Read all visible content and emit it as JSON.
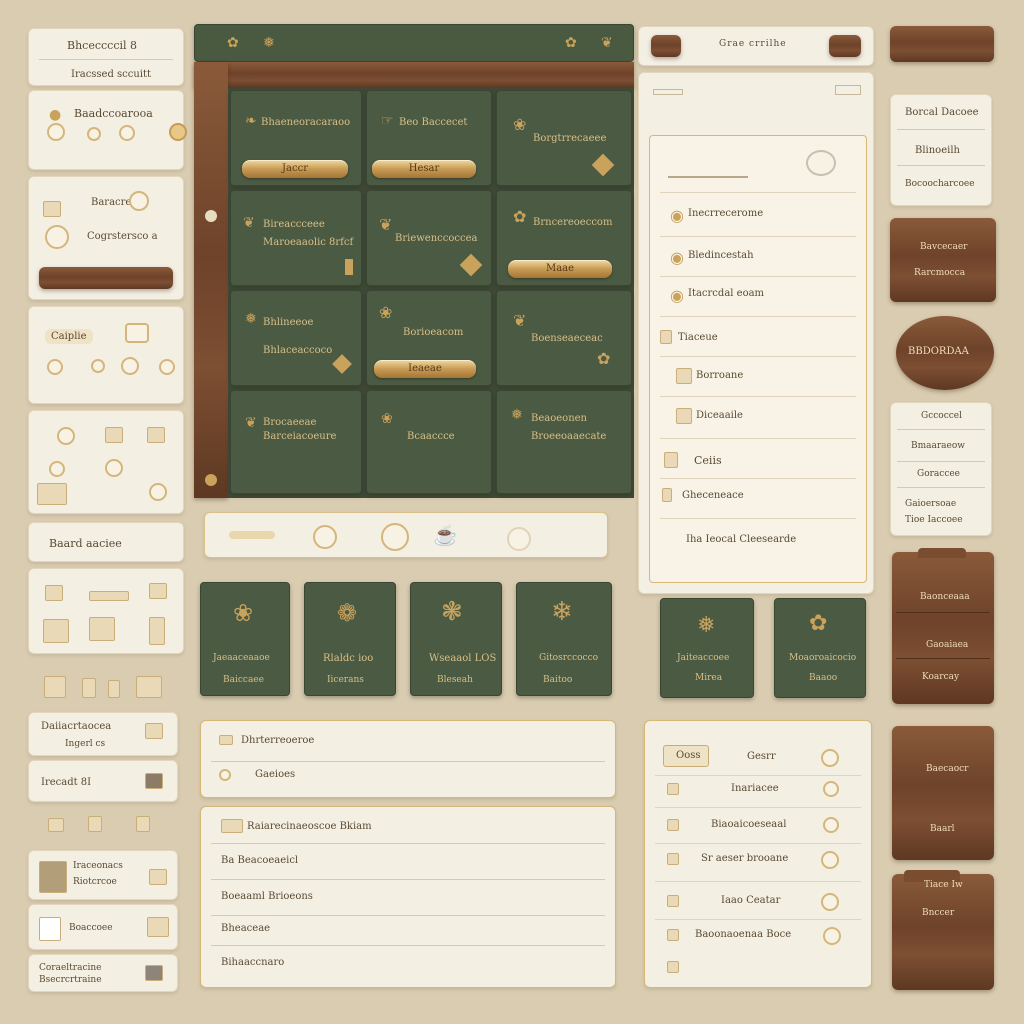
{
  "colors": {
    "background": "#d9ccb1",
    "card": "#f4efe3",
    "green": "#4b5a43",
    "wood": "#7a4d30",
    "gold": "#c9a25c"
  },
  "left_column": {
    "card1_title": "Bhceccccil 8",
    "card1_sub": "Iracssed sccuitt",
    "card2_title": "Baadccoarooa",
    "card3_title": "Baracres",
    "card3_label": "Cogrstersco a",
    "card4_label": "Caiplie",
    "card6_title": "Baard aaciee",
    "list1": [
      "Daiiacrtaocea",
      "Ingerl cs"
    ],
    "list2": "Irecadt 8I",
    "list3_title": "Iraceonacs",
    "list3_sub": "Riotcrcoe",
    "list4": "Boaccoee",
    "list5_title": "Coraeltracine",
    "list5_sub": "Bsecrcrtraine"
  },
  "main_grid": {
    "tiles": [
      {
        "title": "Bhaeneoracaraoo",
        "sub": ""
      },
      {
        "title": "Beo Baccecet",
        "sub": ""
      },
      {
        "title": "Borgtrrecaeee",
        "sub": ""
      },
      {
        "title": "Bireaccceee",
        "sub": "Maroeaaolic 8rfcf"
      },
      {
        "title": "Briewenccoccea",
        "sub": ""
      },
      {
        "title": "Brncereoeccom",
        "sub": ""
      },
      {
        "title": "Bhlineeoe",
        "sub": "Bhlaceaccoco"
      },
      {
        "title": "Borioeacom",
        "sub": ""
      },
      {
        "title": "Boenseaeceac",
        "sub": ""
      },
      {
        "title": "Brocaeeae",
        "sub": "Barceiacoeure"
      },
      {
        "title": "Bcaaccce",
        "sub": ""
      },
      {
        "title": "Beaoeonen",
        "sub": "Broeeoaaecate"
      }
    ],
    "buttons": [
      "Jaccr",
      "Hesar",
      "Maae",
      "Ieaeae"
    ]
  },
  "green_cards": [
    {
      "title": "Jaeaaceaaoe",
      "sub": "Baiccaee"
    },
    {
      "title": "Rlaldc ioo",
      "sub": "Iicerans"
    },
    {
      "title": "Wseaaol LOS",
      "sub": "Bleseah"
    },
    {
      "title": "Gitosrccocco",
      "sub": "Baitoo"
    },
    {
      "title": "Jaiteaccoee",
      "sub": "Mirea"
    },
    {
      "title": "Moaoroaicocio",
      "sub": "Baaoo"
    }
  ],
  "top_bar": {
    "label": "Grae crrilhe"
  },
  "right_panel": {
    "items": [
      "Inecrrecerome",
      "Bledincestah",
      "Itacrcdal eoam",
      "Tiaceue",
      "Borroane",
      "Diceaaile",
      "Ceiis",
      "Gheceneace",
      "Iha Ieocal Cleesearde"
    ]
  },
  "far_right": {
    "note1": "Borcal Dacoee",
    "note2": "Blinoeilh",
    "note3": "Bocoocharcoee",
    "wood1": "Bavcecaer",
    "wood1b": "Rarcmocca",
    "oval": "BBDORDAA",
    "note4": "Gccoccel",
    "note5": "Bmaaraeow",
    "note6": "Goraccee",
    "note7": "Gaioersoae",
    "note7b": "Tioe Iaccoee",
    "folder1": "Baonceaaa",
    "folder1b": "Gaoaiaea",
    "folder1c": "Koarcay",
    "wood2": "Baecaocr",
    "wood2b": "Baarl",
    "folder2": "Tiace Iw",
    "folder2b": "Bnccer"
  },
  "bottom_panel": {
    "header_rows": [
      "Dhrterreoeroe",
      "Gaeioes"
    ],
    "rows": [
      "Raiarecinaeoscoe Bkiam",
      "Ba Beacoeaeicl",
      "Boeaaml Brioeons",
      "Bheaceae",
      "Bihaaccnaro"
    ]
  },
  "bottom_right_panel": {
    "rows": [
      "Gesrr",
      "Inariacee",
      "Biaoaicoeseaal",
      "Sr aeser brooane",
      "Iaao Ceatar",
      "Baoonaoenaa Boce"
    ],
    "header_left": "Ooss"
  }
}
